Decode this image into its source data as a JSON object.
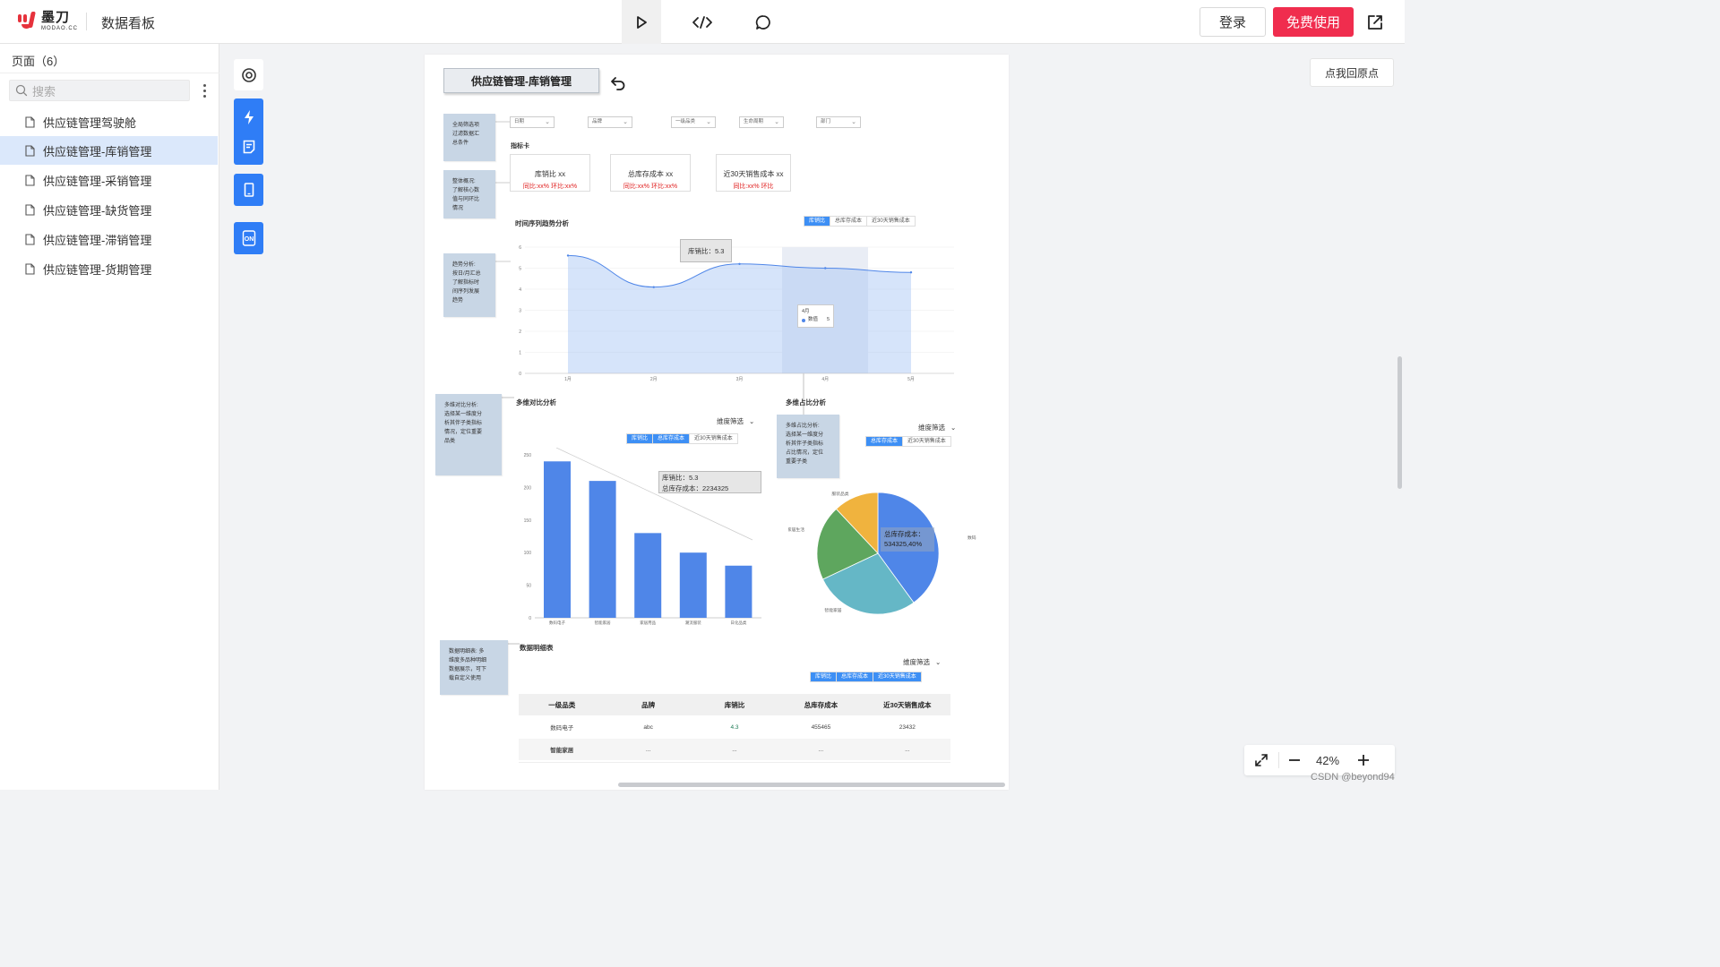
{
  "app": {
    "logo_cn": "墨刀",
    "logo_en": "MODAO.CC",
    "doc_title": "数据看板",
    "login_label": "登录",
    "free_label": "免费使用"
  },
  "sidebar": {
    "title": "页面（6）",
    "search_placeholder": "搜索",
    "pages": [
      {
        "label": "供应链管理驾驶舱"
      },
      {
        "label": "供应链管理-库销管理"
      },
      {
        "label": "供应链管理-采销管理"
      },
      {
        "label": "供应链管理-缺货管理"
      },
      {
        "label": "供应链管理-滞销管理"
      },
      {
        "label": "供应链管理-货期管理"
      }
    ],
    "selected_index": 1
  },
  "canvas": {
    "page_title": "供应链管理-库销管理",
    "reset_label": "点我回原点",
    "zoom": "42%",
    "watermark": "CSDN @beyond94",
    "notes": {
      "filter": "全局筛选项\n过滤数据汇\n总条件",
      "overview": "整体概况:\n了解核心数\n值与同环比\n情况",
      "trend": "趋势分析:\n按日/月汇总\n了解指标时\n间序列发展\n趋势",
      "compare": "多维对比分析:\n选择某一维度分\n析其伴子类指标\n情况，定位重要\n品类",
      "share": "多维占比分析:\n选择某一维度分\n析其伴子类指标\n占比情况，定位\n重要子类",
      "detail": "数据明细表: 多\n维度多品种明细\n数据展示，可下\n载自定义使用"
    },
    "filters": [
      "日期",
      "品牌",
      "一级品类",
      "生命周期",
      "部门"
    ],
    "kpi_section": "指标卡",
    "kpis": [
      {
        "title": "库销比  xx",
        "sub": "同比:xx%  环比:xx%"
      },
      {
        "title": "总库存成本  xx",
        "sub": "同比:xx%  环比:xx%"
      },
      {
        "title": "近30天销售成本  xx",
        "sub": "同比:xx%  环比"
      }
    ],
    "metric_tabs": [
      "库销比",
      "总库存成本",
      "近30天销售成本"
    ],
    "trend_title": "时间序列趋势分析",
    "trend_tooltip": "库销比：5.3",
    "trend_mini_tooltip": {
      "title": "4月",
      "item": "数值",
      "value": "5"
    },
    "compare_title": "多维对比分析",
    "share_title": "多维占比分析",
    "dim_filter_label": "维度筛选",
    "bar_tooltip": {
      "line1": "库销比：5.3",
      "line2": "总库存成本：2234325"
    },
    "pie_tooltip": {
      "line1": "总库存成本：",
      "line2": "534325,40%"
    },
    "detail_title": "数据明细表",
    "table": {
      "headers": [
        "一级品类",
        "品牌",
        "库销比",
        "总库存成本",
        "近30天销售成本"
      ],
      "rows": [
        [
          "数码电子",
          "abc",
          "4.3",
          "455465",
          "23432"
        ],
        [
          "智能家居",
          "...",
          "...",
          "...",
          "..."
        ]
      ]
    },
    "colors": {
      "accent": "#2f7df6",
      "brand_red": "#f02d4e",
      "bar": "#4f86e8",
      "area": "#dbe6f9"
    }
  },
  "chart_data": [
    {
      "type": "area",
      "x": [
        "1月",
        "2月",
        "3月",
        "4月",
        "5月"
      ],
      "values": [
        5.6,
        4.1,
        5.2,
        5.0,
        4.8
      ],
      "ylim": [
        0,
        6
      ],
      "yticks": [
        "0",
        "1",
        "2",
        "3",
        "4",
        "5",
        "6"
      ],
      "title": "时间序列趋势分析"
    },
    {
      "type": "bar",
      "categories": [
        "数码电子",
        "智能家居",
        "家居用品",
        "潮流服装",
        "日化品类"
      ],
      "values": [
        240,
        210,
        130,
        100,
        80
      ],
      "ylim": [
        0,
        250
      ],
      "yticks": [
        "0",
        "50",
        "100",
        "150",
        "200",
        "250"
      ],
      "title": "多维对比分析"
    },
    {
      "type": "pie",
      "labels": [
        "数码电子",
        "智能家居",
        "家居生活",
        "服装品类"
      ],
      "values": [
        40,
        28,
        20,
        12
      ],
      "colors": [
        "#4f86e8",
        "#65b7c6",
        "#5ea65e",
        "#f0b33e"
      ],
      "title": "多维占比分析"
    }
  ]
}
